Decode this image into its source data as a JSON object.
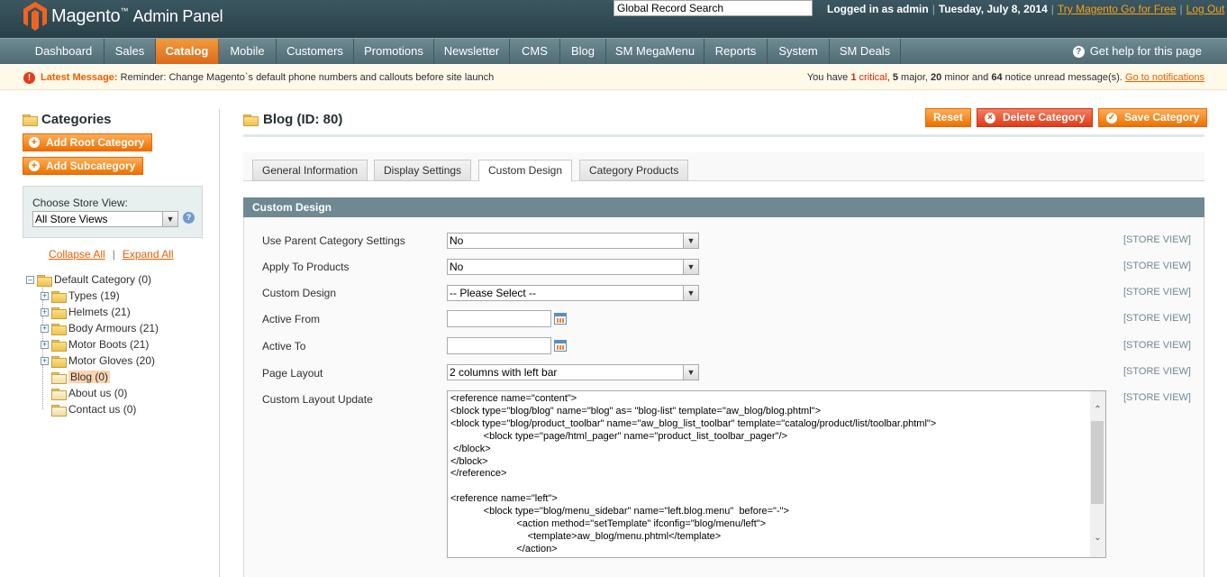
{
  "header": {
    "logo_name": "Magento",
    "logo_tm": "™",
    "logo_suffix": "Admin Panel",
    "search_value": "Global Record Search",
    "logged_in": "Logged in as admin",
    "date": "Tuesday, July 8, 2014",
    "try_link": "Try Magento Go for Free",
    "logout": "Log Out",
    "sep": "|"
  },
  "nav": {
    "items": [
      {
        "label": "Dashboard"
      },
      {
        "label": "Sales"
      },
      {
        "label": "Catalog",
        "active": true
      },
      {
        "label": "Mobile"
      },
      {
        "label": "Customers"
      },
      {
        "label": "Promotions"
      },
      {
        "label": "Newsletter"
      },
      {
        "label": "CMS"
      },
      {
        "label": "Blog"
      },
      {
        "label": "SM MegaMenu"
      },
      {
        "label": "Reports"
      },
      {
        "label": "System"
      },
      {
        "label": "SM Deals"
      }
    ],
    "help": "Get help for this page"
  },
  "message": {
    "label": "Latest Message:",
    "text": "Reminder: Change Magento`s default phone numbers and callouts before site launch",
    "right_prefix": "You have ",
    "critical_count": "1",
    "critical_label": "critical",
    "major": "5",
    "minor": "20",
    "notice": "64",
    "right_mid1": ", ",
    "right_major_label": " major, ",
    "right_minor_label": " minor and ",
    "right_notice_label": " notice unread message(s).",
    "link": "Go to notifications"
  },
  "sidebar": {
    "title": "Categories",
    "add_root": "Add Root Category",
    "add_sub": "Add Subcategory",
    "store_label": "Choose Store View:",
    "store_value": "All Store Views",
    "collapse": "Collapse All",
    "expand": "Expand All",
    "pipe": "|",
    "tree": [
      {
        "label": "Default Category (0)"
      },
      {
        "label": "Types (19)"
      },
      {
        "label": "Helmets (21)"
      },
      {
        "label": "Body Armours (21)"
      },
      {
        "label": "Motor Boots (21)"
      },
      {
        "label": "Motor Gloves (20)"
      },
      {
        "label": "Blog (0)"
      },
      {
        "label": "About us (0)"
      },
      {
        "label": "Contact us (0)"
      }
    ]
  },
  "main": {
    "title": "Blog (ID: 80)",
    "reset": "Reset",
    "delete": "Delete Category",
    "save": "Save Category",
    "tabs": [
      {
        "label": "General Information"
      },
      {
        "label": "Display Settings"
      },
      {
        "label": "Custom Design",
        "active": true
      },
      {
        "label": "Category Products"
      }
    ],
    "section_title": "Custom Design",
    "scope": "[STORE VIEW]",
    "fields": {
      "use_parent": {
        "label": "Use Parent Category Settings",
        "value": "No"
      },
      "apply_products": {
        "label": "Apply To Products",
        "value": "No"
      },
      "custom_design": {
        "label": "Custom Design",
        "value": "-- Please Select --"
      },
      "active_from": {
        "label": "Active From",
        "value": ""
      },
      "active_to": {
        "label": "Active To",
        "value": ""
      },
      "page_layout": {
        "label": "Page Layout",
        "value": "2 columns with left bar"
      },
      "layout_update": {
        "label": "Custom Layout Update",
        "value": "<reference name=\"content\">\n<block type=\"blog/blog\" name=\"blog\" as= \"blog-list\" template=\"aw_blog/blog.phtml\">\n<block type=\"blog/product_toolbar\" name=\"aw_blog_list_toolbar\" template=\"catalog/product/list/toolbar.phtml\">\n            <block type=\"page/html_pager\" name=\"product_list_toolbar_pager\"/>\n </block>\n</block>\n</reference>\n\n<reference name=\"left\">\n            <block type=\"blog/menu_sidebar\" name=\"left.blog.menu\"  before=\"-\">\n                        <action method=\"setTemplate\" ifconfig=\"blog/menu/left\">\n                            <template>aw_blog/menu.phtml</template>\n                        </action>"
      }
    }
  }
}
